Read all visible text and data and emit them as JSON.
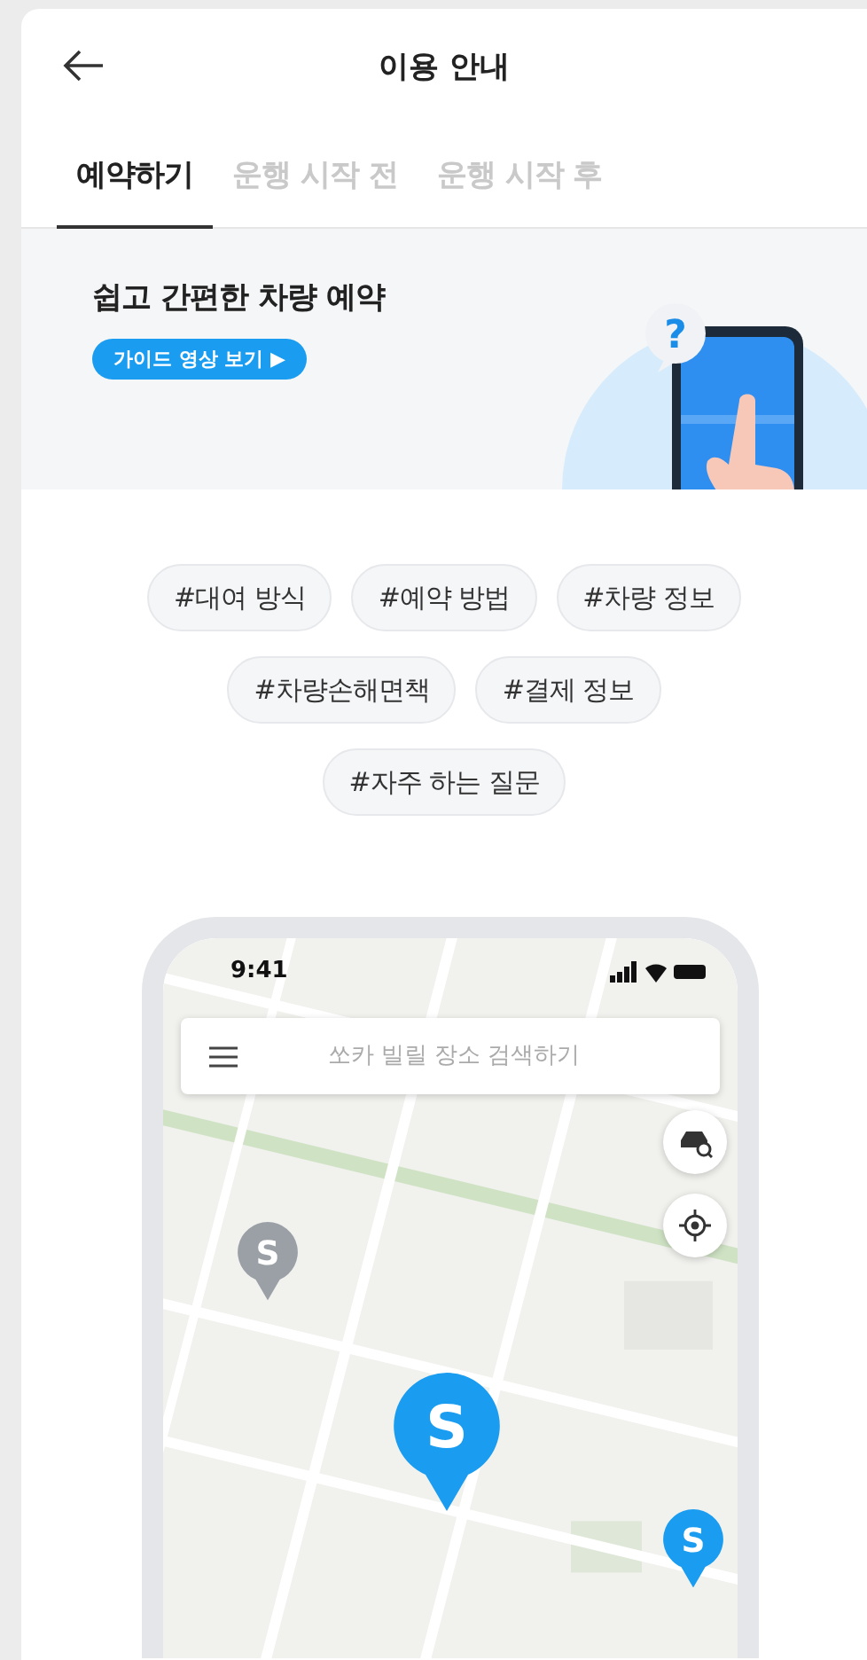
{
  "header": {
    "title": "이용 안내"
  },
  "tabs": [
    {
      "label": "예약하기",
      "selected": true
    },
    {
      "label": "운행 시작 전",
      "selected": false
    },
    {
      "label": "운행 시작 후",
      "selected": false
    }
  ],
  "banner": {
    "title": "쉽고 간편한 차량 예약",
    "button": "가이드 영상 보기 ▶",
    "bubble": "?"
  },
  "tag_rows": [
    [
      "#대여 방식",
      "#예약 방법",
      "#차량 정보"
    ],
    [
      "#차량손해면책",
      "#결제 정보"
    ],
    [
      "#자주 하는 질문"
    ]
  ],
  "phone": {
    "time": "9:41",
    "search": {
      "placeholder": "쏘카 빌릴 장소 검색하기"
    },
    "pins": [
      {
        "label": "S",
        "color": "#9aa0a6",
        "kind": "small"
      },
      {
        "label": "S",
        "color": "#1a9cf0",
        "kind": "large"
      },
      {
        "label": "S",
        "color": "#1a9cf0",
        "kind": "small"
      }
    ]
  }
}
